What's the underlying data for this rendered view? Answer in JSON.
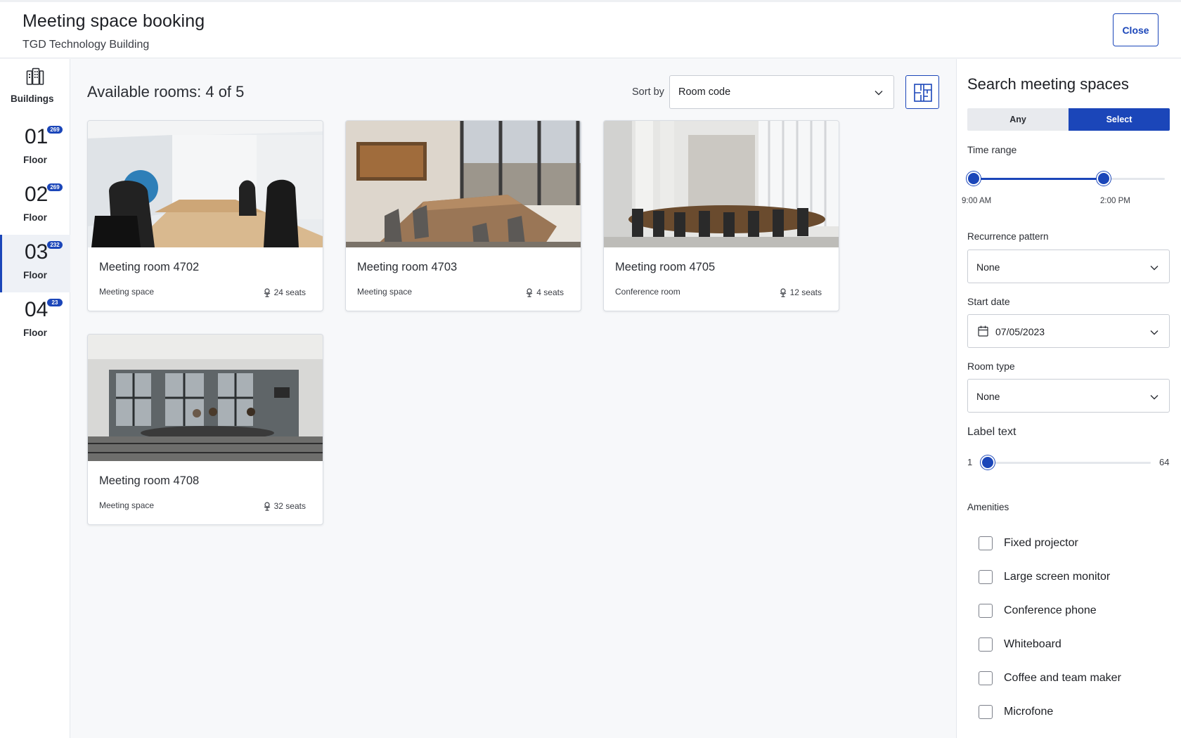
{
  "header": {
    "title": "Meeting space booking",
    "subtitle": "TGD Technology Building",
    "close_label": "Close"
  },
  "rail": {
    "buildings_label": "Buildings",
    "floors": [
      {
        "number": "01",
        "badge": "269",
        "label": "Floor",
        "active": false
      },
      {
        "number": "02",
        "badge": "269",
        "label": "Floor",
        "active": false
      },
      {
        "number": "03",
        "badge": "232",
        "label": "Floor",
        "active": true
      },
      {
        "number": "04",
        "badge": "23",
        "label": "Floor",
        "active": false
      }
    ]
  },
  "main": {
    "available_label": "Available rooms: 4 of 5",
    "sort_label": "Sort by",
    "sort_value": "Room code",
    "rooms": [
      {
        "name": "Meeting room 4702",
        "type": "Meeting space",
        "seats": "24 seats"
      },
      {
        "name": "Meeting room 4703",
        "type": "Meeting space",
        "seats": "4 seats"
      },
      {
        "name": "Meeting room 4705",
        "type": "Conference room",
        "seats": "12 seats"
      },
      {
        "name": "Meeting room 4708",
        "type": "Meeting space",
        "seats": "32 seats"
      }
    ]
  },
  "panel": {
    "title": "Search meeting spaces",
    "segment": {
      "any": "Any",
      "select": "Select",
      "selected": "Select"
    },
    "time_range": {
      "label": "Time range",
      "start": "9:00 AM",
      "end": "2:00 PM",
      "start_fraction": 0.0,
      "end_fraction": 0.68
    },
    "recurrence": {
      "label": "Recurrence pattern",
      "value": "None"
    },
    "start_date": {
      "label": "Start date",
      "value": "07/05/2023"
    },
    "room_type": {
      "label": "Room type",
      "value": "None"
    },
    "label_text": {
      "label": "Label text",
      "min": "1",
      "max": "64",
      "value": 1
    },
    "amenities": {
      "label": "Amenities",
      "items": [
        {
          "label": "Fixed projector",
          "checked": false
        },
        {
          "label": "Large screen monitor",
          "checked": false
        },
        {
          "label": "Conference phone",
          "checked": false
        },
        {
          "label": "Whiteboard",
          "checked": false
        },
        {
          "label": "Coffee and team maker",
          "checked": false
        },
        {
          "label": "Microfone",
          "checked": false
        }
      ]
    }
  },
  "colors": {
    "accent": "#1b46b9",
    "background": "#f7f8fa",
    "border": "#c9cdd4"
  }
}
